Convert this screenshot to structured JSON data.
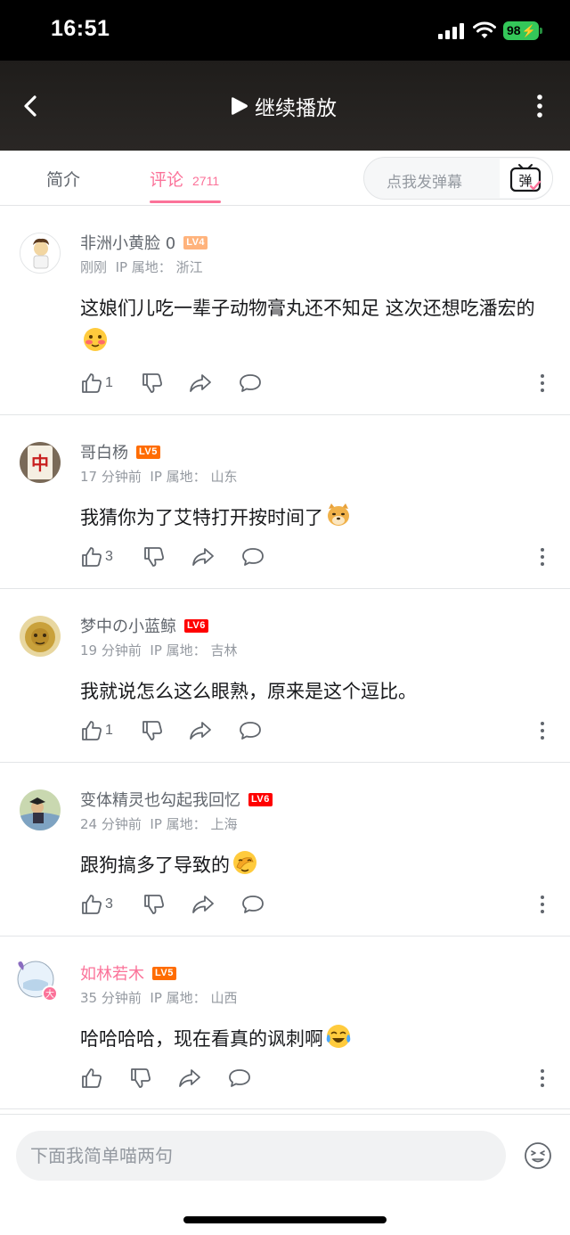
{
  "status_bar": {
    "time": "16:51",
    "battery": "98"
  },
  "video_bar": {
    "continue_label": "继续播放"
  },
  "tabs": {
    "intro": "简介",
    "comments": "评论",
    "comments_count": "2711"
  },
  "danmaku": {
    "placeholder": "点我发弹幕",
    "icon_label": "弹"
  },
  "comments": [
    {
      "username": "非洲小黄脸 0",
      "level": "LV4",
      "time": "刚刚",
      "ip_label": "IP 属地：",
      "ip": "浙江",
      "text": "这娘们儿吃一辈子动物膏丸还不知足 这次还想吃潘宏的",
      "likes": "1"
    },
    {
      "username": "哥白杨",
      "level": "LV5",
      "time": "17 分钟前",
      "ip_label": "IP 属地：",
      "ip": "山东",
      "text": "我猜你为了艾特打开按时间了",
      "likes": "3"
    },
    {
      "username": "梦中の小蓝鲸",
      "level": "LV6",
      "time": "19 分钟前",
      "ip_label": "IP 属地：",
      "ip": "吉林",
      "text": "我就说怎么这么眼熟，原来是这个逗比。",
      "likes": "1"
    },
    {
      "username": "变体精灵也勾起我回忆",
      "level": "LV6",
      "time": "24 分钟前",
      "ip_label": "IP 属地：",
      "ip": "上海",
      "text": "跟狗搞多了导致的",
      "likes": "3"
    },
    {
      "username": "如林若木",
      "level": "LV5",
      "time": "35 分钟前",
      "ip_label": "IP 属地：",
      "ip": "山西",
      "text": "哈哈哈哈，现在看真的讽刺啊",
      "likes": ""
    }
  ],
  "input": {
    "placeholder": "下面我简单喵两句"
  },
  "colors": {
    "accent": "#fb7299",
    "lv4": "#ffb37c",
    "lv5": "#ff6c00",
    "lv6": "#ff0000",
    "muted": "#9499a0"
  }
}
